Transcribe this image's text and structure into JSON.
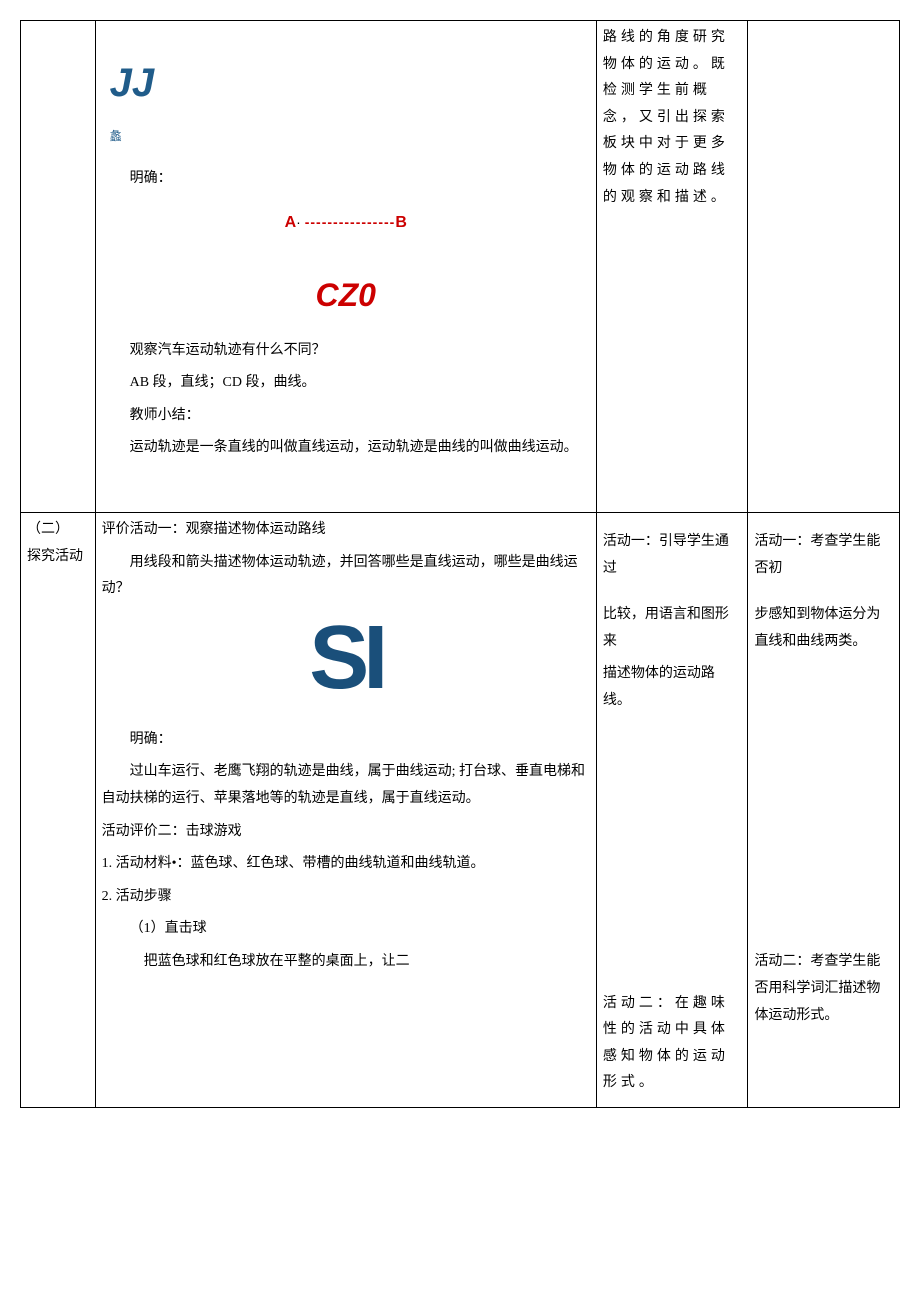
{
  "row1": {
    "col2": {
      "jj": "JJ",
      "yi": "蠡",
      "mingque": "明确：",
      "A": "A",
      "dot": "·",
      "dashes": "----------------",
      "B": "B",
      "cz0": "CZ0",
      "q1": "观察汽车运动轨迹有什么不同？",
      "q2": "AB 段，直线；CD 段，曲线。",
      "q3": "教师小结：",
      "q4": "运动轨迹是一条直线的叫做直线运动，运动轨迹是曲线的叫做曲线运动。"
    },
    "col3": {
      "p1": "路线的角度研究物体的运动。既检测学生前概念，又引出探索板块中对于更多物体的运动路线的观察和描述。"
    }
  },
  "row2": {
    "col1a": "（二）",
    "col1b": "探究活动",
    "col2": {
      "t1": "评价活动一：观察描述物体运动路线",
      "t2": "用线段和箭头描述物体运动轨迹，并回答哪些是直线运动，哪些是曲线运动？",
      "sl": "SI",
      "m1": "明确：",
      "m2": "过山车运行、老鹰飞翔的轨迹是曲线，属于曲线运动; 打台球、垂直电梯和自动扶梯的运行、苹果落地等的轨迹是直线，属于直线运动。",
      "a2t": "活动评价二：击球游戏",
      "a2m": "1. 活动材料•：蓝色球、红色球、带槽的曲线轨道和曲线轨道。",
      "a2s": "2. 活动步骤",
      "a2s1": "（1）直击球",
      "a2s1d": "把蓝色球和红色球放在平整的桌面上，让二"
    },
    "col3": {
      "a1a": "活动一：引导学生通过",
      "a1b": "比较，用语言和图形来",
      "a1c": "描述物体的运动路线。",
      "a2a": "活动二：在趣味性的活动中具体感知物体的运动形式。"
    },
    "col4": {
      "a1a": "活动一：考查学生能否初",
      "a1b": "步感知到物体运分为直线和曲线两类。",
      "a2a": "活动二：考查学生能否用科学词汇描述物体运动形式。"
    }
  }
}
